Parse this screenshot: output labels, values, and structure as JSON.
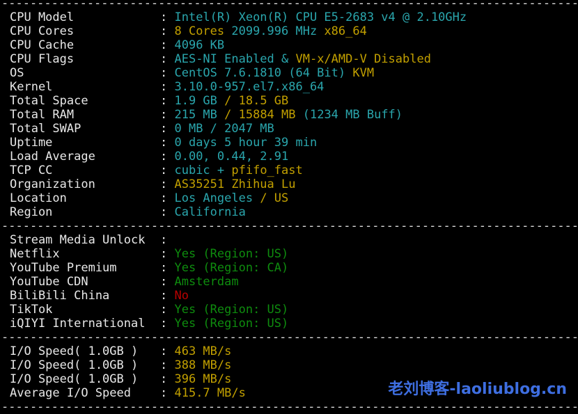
{
  "terminal": {
    "background": "#000000",
    "colors": {
      "label": "#e8e8e8",
      "cyan": "#2aa6ad",
      "yellow": "#c2a000",
      "green": "#0e8c0e",
      "red": "#b80000",
      "separator": "#dcdcdc",
      "watermark": "#3e6ee0"
    },
    "separator_char_count": 81,
    "blocks": [
      {
        "type": "separator"
      },
      {
        "type": "row",
        "label": "CPU Model",
        "segments": [
          {
            "text": "Intel(R) Xeon(R) CPU E5-2683 v4 @ 2.10GHz",
            "color": "cyan"
          }
        ]
      },
      {
        "type": "row",
        "label": "CPU Cores",
        "segments": [
          {
            "text": "8 Cores ",
            "color": "yellow"
          },
          {
            "text": "2099.996 MHz ",
            "color": "cyan"
          },
          {
            "text": "x86_64",
            "color": "yellow"
          }
        ]
      },
      {
        "type": "row",
        "label": "CPU Cache",
        "segments": [
          {
            "text": "4096 KB",
            "color": "cyan"
          }
        ]
      },
      {
        "type": "row",
        "label": "CPU Flags",
        "segments": [
          {
            "text": "AES-NI Enabled & ",
            "color": "cyan"
          },
          {
            "text": "VM-x/AMD-V Disabled",
            "color": "yellow"
          }
        ]
      },
      {
        "type": "row",
        "label": "OS",
        "segments": [
          {
            "text": "CentOS 7.6.1810 (64 Bit) ",
            "color": "cyan"
          },
          {
            "text": "KVM",
            "color": "yellow"
          }
        ]
      },
      {
        "type": "row",
        "label": "Kernel",
        "segments": [
          {
            "text": "3.10.0-957.el7.x86_64",
            "color": "cyan"
          }
        ]
      },
      {
        "type": "row",
        "label": "Total Space",
        "segments": [
          {
            "text": "1.9 GB ",
            "color": "cyan"
          },
          {
            "text": "/ 18.5 GB",
            "color": "yellow"
          }
        ]
      },
      {
        "type": "row",
        "label": "Total RAM",
        "segments": [
          {
            "text": "215 MB ",
            "color": "cyan"
          },
          {
            "text": "/ 15884 MB ",
            "color": "yellow"
          },
          {
            "text": "(1234 MB Buff)",
            "color": "cyan"
          }
        ]
      },
      {
        "type": "row",
        "label": "Total SWAP",
        "segments": [
          {
            "text": "0 MB / 2047 MB",
            "color": "cyan"
          }
        ]
      },
      {
        "type": "row",
        "label": "Uptime",
        "segments": [
          {
            "text": "0 days 5 hour 39 min",
            "color": "cyan"
          }
        ]
      },
      {
        "type": "row",
        "label": "Load Average",
        "segments": [
          {
            "text": "0.00, 0.44, 2.91",
            "color": "cyan"
          }
        ]
      },
      {
        "type": "row",
        "label": "TCP CC",
        "segments": [
          {
            "text": "cubic + ",
            "color": "cyan"
          },
          {
            "text": "pfifo_fast",
            "color": "yellow"
          }
        ]
      },
      {
        "type": "row",
        "label": "Organization",
        "segments": [
          {
            "text": "AS35251 Zhihua Lu",
            "color": "yellow"
          }
        ]
      },
      {
        "type": "row",
        "label": "Location",
        "segments": [
          {
            "text": "Los Angeles ",
            "color": "cyan"
          },
          {
            "text": "/ US",
            "color": "yellow"
          }
        ]
      },
      {
        "type": "row",
        "label": "Region",
        "segments": [
          {
            "text": "California",
            "color": "cyan"
          }
        ]
      },
      {
        "type": "separator"
      },
      {
        "type": "row",
        "label": "Stream Media Unlock",
        "segments": []
      },
      {
        "type": "row",
        "label": "Netflix",
        "segments": [
          {
            "text": "Yes (Region: US)",
            "color": "green"
          }
        ]
      },
      {
        "type": "row",
        "label": "YouTube Premium",
        "segments": [
          {
            "text": "Yes (Region: CA)",
            "color": "green"
          }
        ]
      },
      {
        "type": "row",
        "label": "YouTube CDN",
        "segments": [
          {
            "text": "Amsterdam",
            "color": "green"
          }
        ]
      },
      {
        "type": "row",
        "label": "BiliBili China",
        "segments": [
          {
            "text": "No",
            "color": "red"
          }
        ]
      },
      {
        "type": "row",
        "label": "TikTok",
        "segments": [
          {
            "text": "Yes (Region: US)",
            "color": "green"
          }
        ]
      },
      {
        "type": "row",
        "label": "iQIYI International",
        "segments": [
          {
            "text": "Yes (Region: US)",
            "color": "green"
          }
        ]
      },
      {
        "type": "separator"
      },
      {
        "type": "row",
        "label": "I/O Speed( 1.0GB )",
        "segments": [
          {
            "text": "463 MB/s",
            "color": "yellow"
          }
        ]
      },
      {
        "type": "row",
        "label": "I/O Speed( 1.0GB )",
        "segments": [
          {
            "text": "388 MB/s",
            "color": "yellow"
          }
        ]
      },
      {
        "type": "row",
        "label": "I/O Speed( 1.0GB )",
        "segments": [
          {
            "text": "396 MB/s",
            "color": "yellow"
          }
        ]
      },
      {
        "type": "row",
        "label": "Average I/O Speed",
        "segments": [
          {
            "text": "415.7 MB/s",
            "color": "yellow"
          }
        ]
      },
      {
        "type": "separator"
      }
    ],
    "watermark": "老刘博客-laoliublog.cn"
  }
}
